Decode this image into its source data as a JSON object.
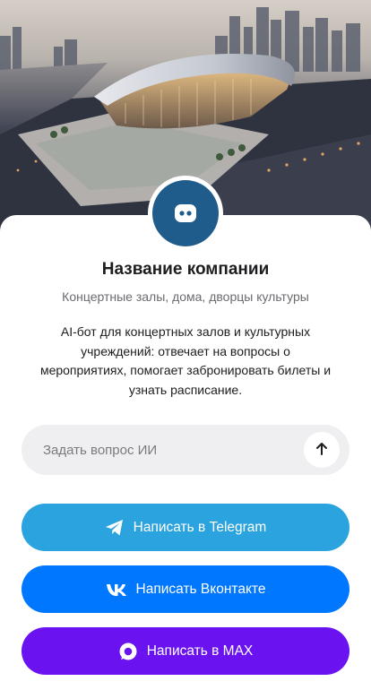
{
  "company": {
    "name": "Название компании",
    "category": "Концертные залы, дома, дворцы культуры",
    "description": "AI-бот для концертных залов и культурных учреждений: отвечает на вопросы о мероприятиях, помогает забронировать билеты и узнать расписание."
  },
  "ask": {
    "placeholder": "Задать вопрос ИИ",
    "value": ""
  },
  "buttons": {
    "telegram": {
      "label": "Написать в Telegram",
      "icon": "telegram-icon",
      "color": "#2aa3de"
    },
    "vk": {
      "label": "Написать Вконтакте",
      "icon": "vk-icon",
      "color": "#0077ff"
    },
    "max": {
      "label": "Написать в MAX",
      "icon": "max-icon",
      "color": "#6a12f0"
    }
  },
  "colors": {
    "avatar": "#1f5c8c",
    "input_bg": "#efeff1"
  },
  "icons": {
    "avatar": "chat-bot-icon",
    "send": "arrow-up-icon"
  }
}
